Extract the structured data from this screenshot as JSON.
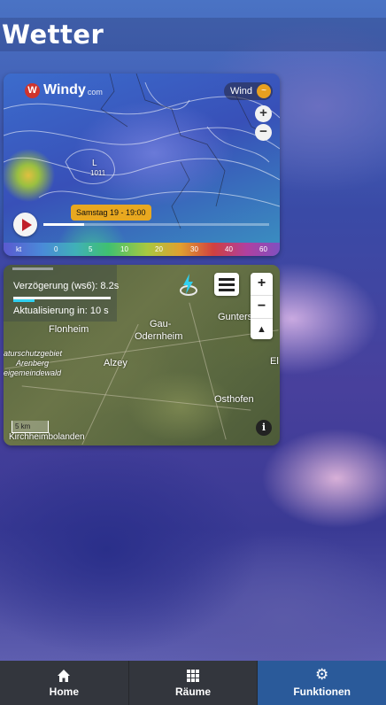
{
  "page": {
    "title": "Wetter"
  },
  "windy": {
    "brand": "Windy",
    "brand_suffix": "com",
    "layer_label": "Wind",
    "zoom_in": "+",
    "zoom_out": "−",
    "time_label": "Samstag 19 - 19:00",
    "timeline_progress": 0.18,
    "legend_unit": "kt",
    "legend_ticks": [
      "0",
      "5",
      "10",
      "20",
      "30",
      "40",
      "60"
    ],
    "map_labels": [
      "L",
      "1011"
    ]
  },
  "lightning": {
    "delay_text": "Verzögerung (ws6): 8.2s",
    "update_text": "Aktualisierung in: 10 s",
    "zoom_in": "+",
    "zoom_out": "−",
    "compass": "▲",
    "scale_label": "5 km",
    "info": "i",
    "places": [
      "Flonheim",
      "Gau-",
      "Odernheim",
      "Alzey",
      "Gunters",
      "Osthofen",
      "Kirchheimbolanden",
      "aturschutzgebiet",
      "Arenberg",
      "eigemeindewald",
      "El"
    ]
  },
  "nav": {
    "items": [
      {
        "label": "Home",
        "icon": "home-icon",
        "active": false
      },
      {
        "label": "Räume",
        "icon": "grid-icon",
        "active": false
      },
      {
        "label": "Funktionen",
        "icon": "gear-icon",
        "active": true
      }
    ]
  }
}
